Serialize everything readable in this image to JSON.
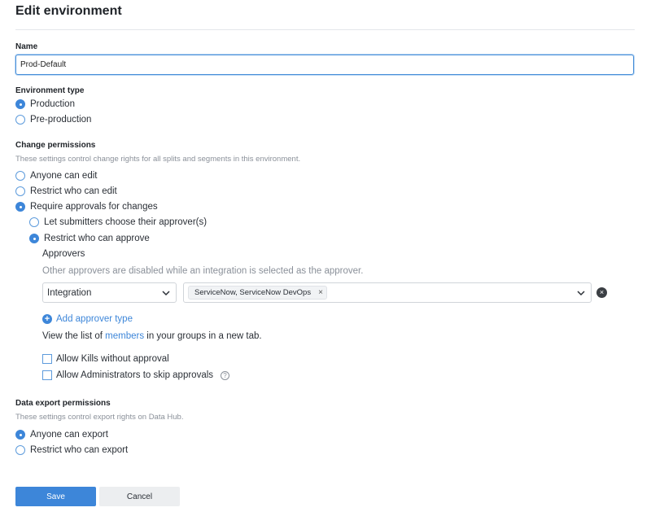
{
  "page": {
    "title": "Edit environment"
  },
  "name": {
    "label": "Name",
    "value": "Prod-Default"
  },
  "env_type": {
    "label": "Environment type",
    "options": [
      {
        "label": "Production",
        "checked": true
      },
      {
        "label": "Pre-production",
        "checked": false
      }
    ]
  },
  "change_permissions": {
    "label": "Change permissions",
    "help": "These settings control change rights for all splits and segments in this environment.",
    "options": [
      {
        "label": "Anyone can edit",
        "checked": false
      },
      {
        "label": "Restrict who can edit",
        "checked": false
      },
      {
        "label": "Require approvals for changes",
        "checked": true
      }
    ],
    "sub_options": [
      {
        "label": "Let submitters choose their approver(s)",
        "checked": false
      },
      {
        "label": "Restrict who can approve",
        "checked": true
      }
    ],
    "approvers_label": "Approvers",
    "approvers_note": "Other approvers are disabled while an integration is selected as the approver.",
    "approver_type_value": "Integration",
    "approver_chip": "ServiceNow, ServiceNow DevOps",
    "chip_remove": "×",
    "clear_icon": "×",
    "add_approver_label": "Add approver type",
    "members_prefix": "View the list of",
    "members_link": "members",
    "members_suffix": "in your groups in a new tab.",
    "checkboxes": [
      {
        "label": "Allow Kills without approval",
        "checked": false
      },
      {
        "label": "Allow Administrators to skip approvals",
        "checked": false
      }
    ],
    "info_glyph": "?"
  },
  "data_export": {
    "label": "Data export permissions",
    "help": "These settings control export rights on Data Hub.",
    "options": [
      {
        "label": "Anyone can export",
        "checked": true
      },
      {
        "label": "Restrict who can export",
        "checked": false
      }
    ]
  },
  "actions": {
    "save_label": "Save",
    "cancel_label": "Cancel"
  },
  "colors": {
    "accent": "#3d86d9",
    "text": "#2a2f36",
    "muted": "#8a9099"
  }
}
